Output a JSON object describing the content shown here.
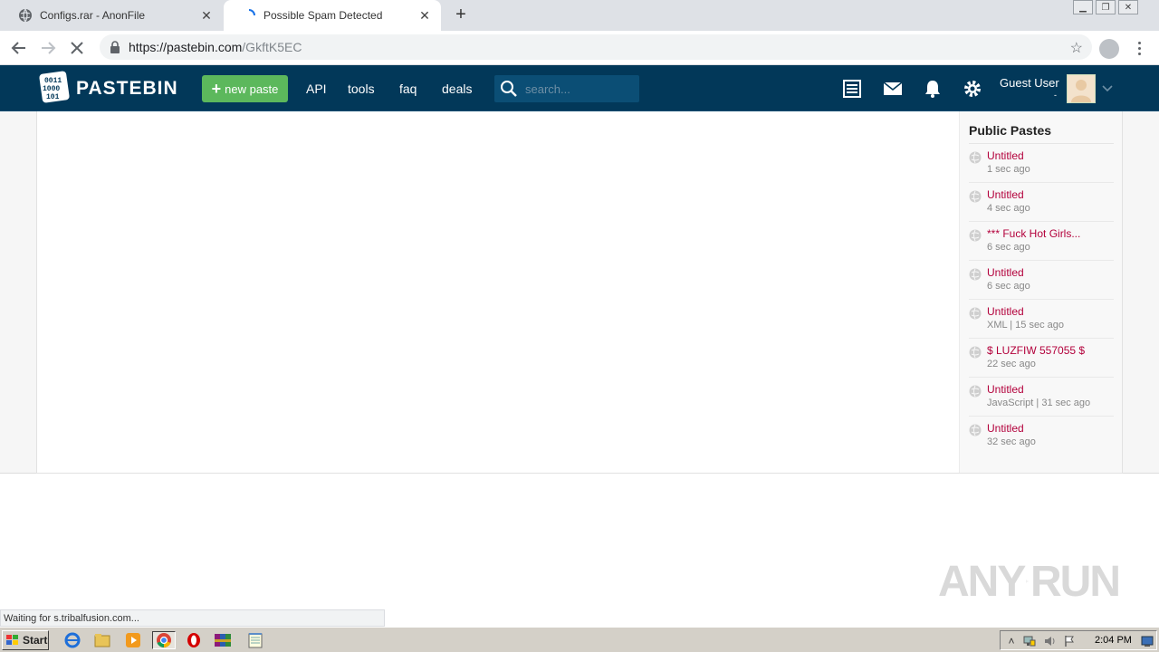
{
  "browser": {
    "tabs": [
      {
        "title": "Configs.rar - AnonFile",
        "icon": "globe-icon",
        "active": false
      },
      {
        "title": "Possible Spam Detected",
        "icon": "loading-spinner-icon",
        "active": true
      }
    ],
    "new_tab_label": "+",
    "url_host": "https://pastebin.com",
    "url_path": "/GkftK5EC",
    "status_text": "Waiting for s.tribalfusion.com..."
  },
  "header": {
    "brand": "PASTEBIN",
    "new_paste_label": "new paste",
    "nav": {
      "api": "API",
      "tools": "tools",
      "faq": "faq",
      "deals": "deals"
    },
    "search_placeholder": "search...",
    "user_name": "Guest User",
    "user_sub": "-",
    "colors": {
      "header_bg": "#023859",
      "new_paste_bg": "#5cb85c"
    }
  },
  "sidebar": {
    "title": "Public Pastes",
    "items": [
      {
        "title": "Untitled",
        "meta": "1 sec ago"
      },
      {
        "title": "Untitled",
        "meta": "4 sec ago"
      },
      {
        "title": "*** Fuck Hot Girls...",
        "meta": "6 sec ago"
      },
      {
        "title": "Untitled",
        "meta": "6 sec ago"
      },
      {
        "title": "Untitled",
        "meta": "XML | 15 sec ago"
      },
      {
        "title": "$ LUZFIW 557055 $",
        "meta": "22 sec ago"
      },
      {
        "title": "Untitled",
        "meta": "JavaScript | 31 sec ago"
      },
      {
        "title": "Untitled",
        "meta": "32 sec ago"
      }
    ],
    "link_color": "#b3003b"
  },
  "watermark": {
    "left": "ANY",
    "right": "RUN"
  },
  "taskbar": {
    "start_label": "Start",
    "clock": "2:04 PM"
  }
}
